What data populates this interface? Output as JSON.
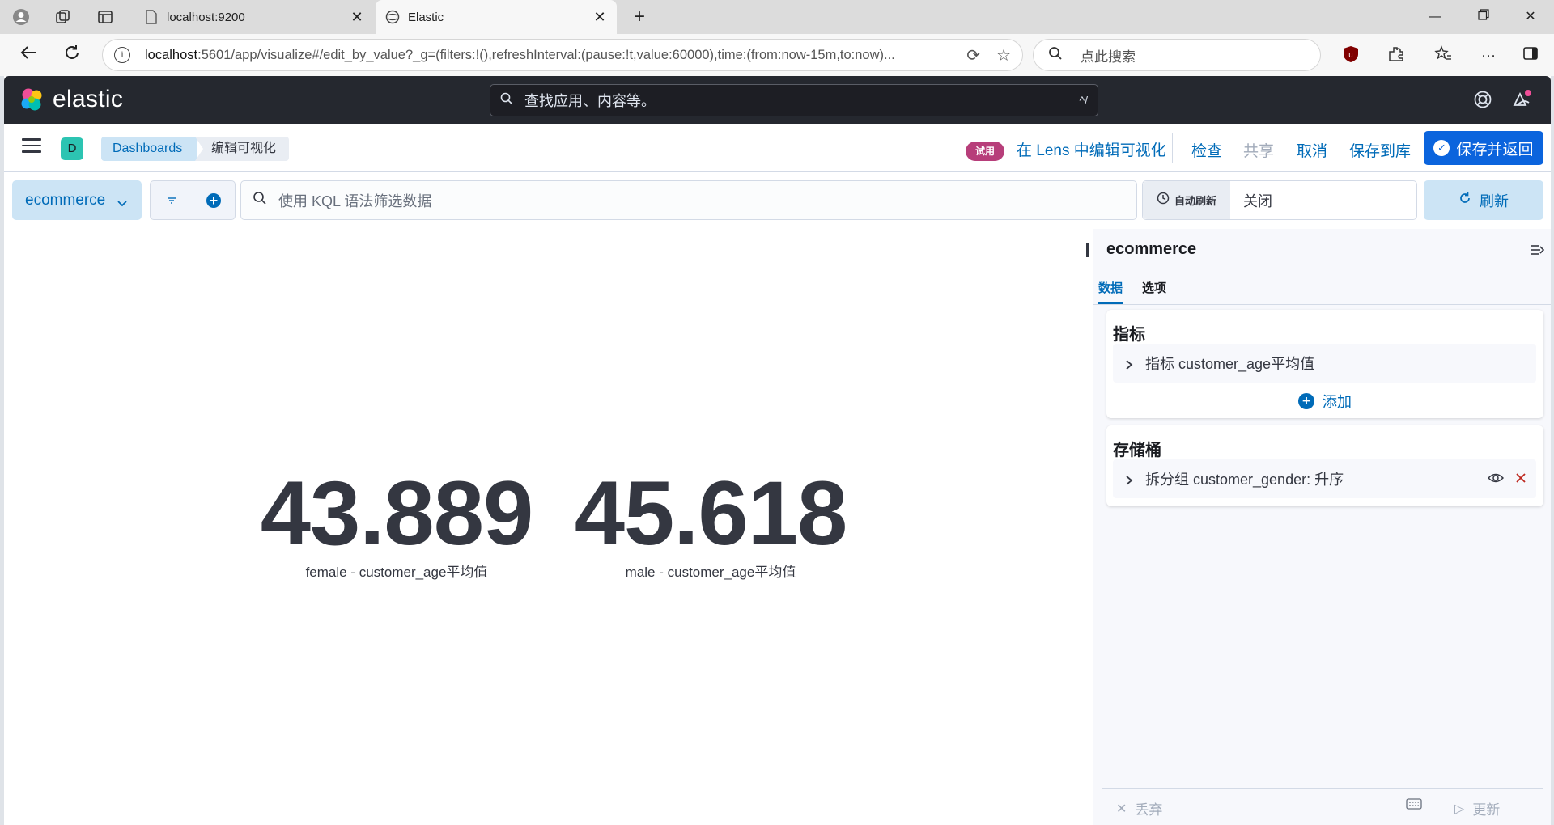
{
  "browser": {
    "tabs": [
      {
        "title": "localhost:9200",
        "active": false
      },
      {
        "title": "Elastic",
        "active": true
      }
    ],
    "url_host": "localhost",
    "url_rest": ":5601/app/visualize#/edit_by_value?_g=(filters:!(),refreshInterval:(pause:!t,value:60000),time:(from:now-15m,to:now)...",
    "search_placeholder": "点此搜索"
  },
  "kibana": {
    "logo_text": "elastic",
    "search_placeholder": "查找应用、内容等。",
    "search_hint": "^/",
    "space_initial": "D",
    "breadcrumbs": [
      "Dashboards",
      "编辑可视化"
    ],
    "beta_label": "试用",
    "lens_link": "在 Lens 中编辑可视化",
    "actions": {
      "inspect": "检查",
      "share": "共享",
      "cancel": "取消",
      "save_to_library": "保存到库",
      "save_and_return": "保存并返回"
    },
    "data_view": "ecommerce",
    "kql_placeholder": "使用 KQL 语法筛选数据",
    "auto_refresh_label": "自动刷新",
    "auto_refresh_value": "关闭",
    "refresh_label": "刷新"
  },
  "metrics": [
    {
      "value": "43.889",
      "label": "female - customer_age平均值"
    },
    {
      "value": "45.618",
      "label": "male - customer_age平均值"
    }
  ],
  "panel": {
    "title": "ecommerce",
    "tabs": [
      "数据",
      "选项"
    ],
    "metrics_section": {
      "title": "指标",
      "item": "指标 customer_age平均值",
      "add_label": "添加"
    },
    "buckets_section": {
      "title": "存储桶",
      "item": "拆分组 customer_gender: 升序"
    },
    "footer": {
      "discard": "丢弃",
      "update": "更新"
    }
  },
  "colors": {
    "header_bg": "#25282f",
    "primary": "#006bb8",
    "save_button": "#0b64dd",
    "beta_badge": "#b73e7a",
    "space_badge": "#2cc4b2",
    "danger": "#bd271e"
  }
}
